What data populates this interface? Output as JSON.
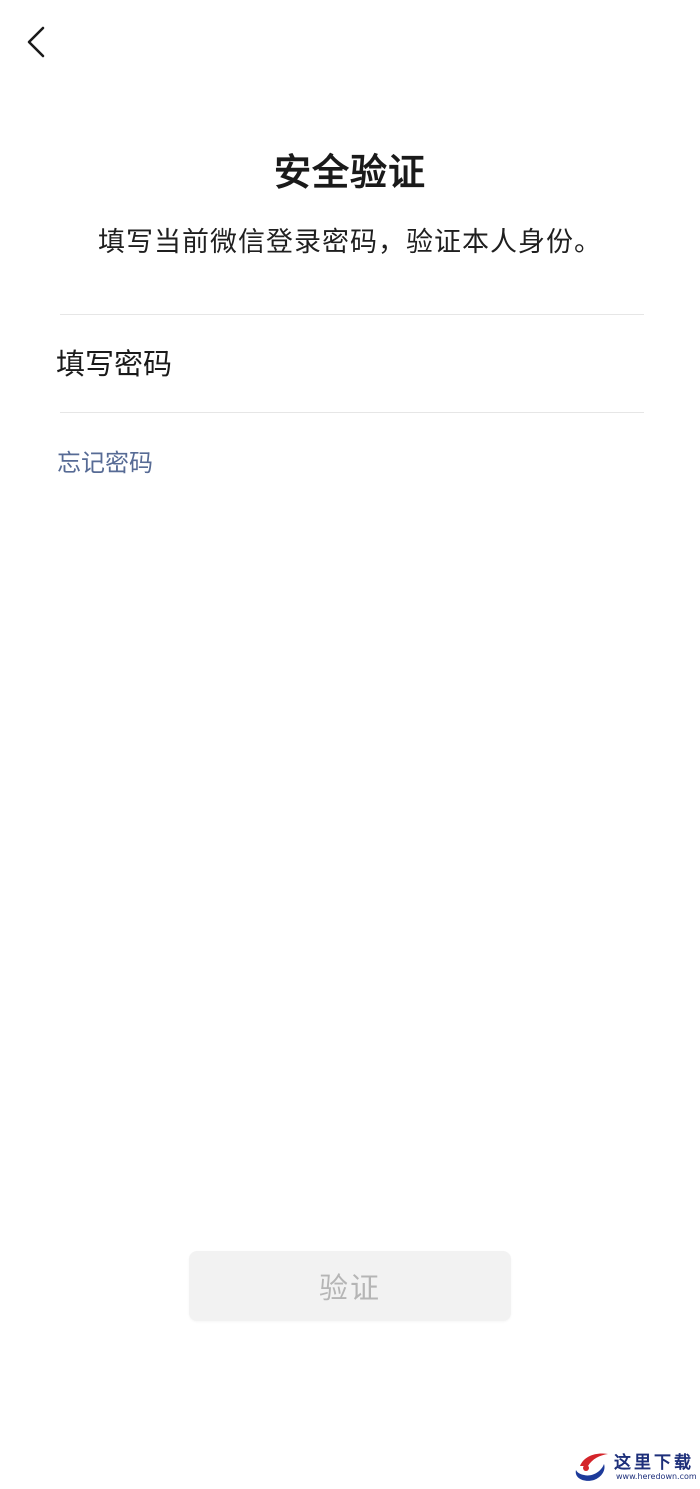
{
  "header": {
    "back_icon": "chevron-left-icon"
  },
  "main": {
    "title": "安全验证",
    "subtitle": "填写当前微信登录密码，验证本人身份。",
    "password": {
      "placeholder": "填写密码",
      "value": ""
    },
    "forgot_label": "忘记密码",
    "verify_label": "验证"
  },
  "watermark": {
    "text": "这里下载",
    "url": "www.heredown.com"
  },
  "colors": {
    "link": "#576b95",
    "button_bg_disabled": "#f2f2f2",
    "button_text_disabled": "#b5b5b5",
    "divider": "#e6e6e6"
  }
}
